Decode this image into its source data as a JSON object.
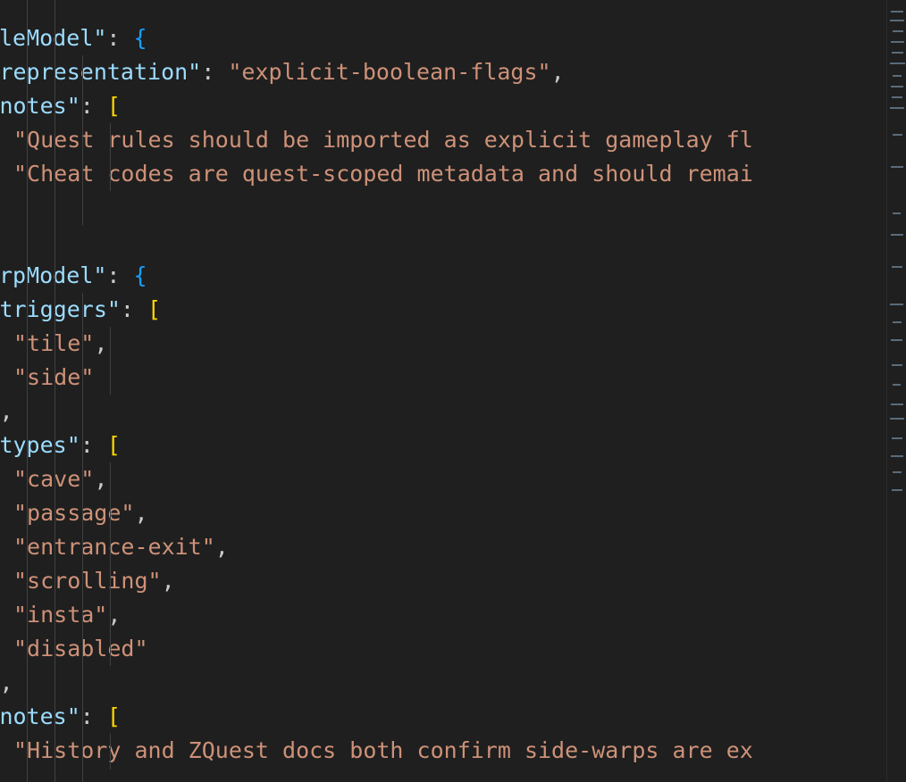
{
  "editor": {
    "language": "json",
    "colors": {
      "background": "#1f1f1f",
      "key": "#9cdcfe",
      "string": "#ce9178",
      "punctuation": "#cccccc",
      "bracket_level_1": "#179fff",
      "bracket_level_2": "#ffd700",
      "indent_guide": "#404040"
    },
    "lines": [
      {
        "indent": 3,
        "tokens": [
          {
            "t": "b1",
            "v": "}"
          },
          {
            "t": "punc",
            "v": ","
          }
        ]
      },
      {
        "indent": 3,
        "tokens": [
          {
            "t": "key",
            "v": "\"ruleModel\""
          },
          {
            "t": "punc",
            "v": ": "
          },
          {
            "t": "b1",
            "v": "{"
          }
        ]
      },
      {
        "indent": 4,
        "tokens": [
          {
            "t": "key",
            "v": "\"representation\""
          },
          {
            "t": "punc",
            "v": ": "
          },
          {
            "t": "str",
            "v": "\"explicit-boolean-flags\""
          },
          {
            "t": "punc",
            "v": ","
          }
        ]
      },
      {
        "indent": 4,
        "tokens": [
          {
            "t": "key",
            "v": "\"notes\""
          },
          {
            "t": "punc",
            "v": ": "
          },
          {
            "t": "b2",
            "v": "["
          }
        ]
      },
      {
        "indent": 5,
        "tokens": [
          {
            "t": "str",
            "v": "\"Quest rules should be imported as explicit gameplay fl"
          }
        ]
      },
      {
        "indent": 5,
        "tokens": [
          {
            "t": "str",
            "v": "\"Cheat codes are quest-scoped metadata and should remai"
          }
        ]
      },
      {
        "indent": 4,
        "tokens": [
          {
            "t": "b2",
            "v": "]"
          }
        ]
      },
      {
        "indent": 3,
        "tokens": [
          {
            "t": "b1",
            "v": "}"
          },
          {
            "t": "punc",
            "v": ","
          }
        ]
      },
      {
        "indent": 3,
        "tokens": [
          {
            "t": "key",
            "v": "\"warpModel\""
          },
          {
            "t": "punc",
            "v": ": "
          },
          {
            "t": "b1",
            "v": "{"
          }
        ]
      },
      {
        "indent": 4,
        "tokens": [
          {
            "t": "key",
            "v": "\"triggers\""
          },
          {
            "t": "punc",
            "v": ": "
          },
          {
            "t": "b2",
            "v": "["
          }
        ]
      },
      {
        "indent": 5,
        "tokens": [
          {
            "t": "str",
            "v": "\"tile\""
          },
          {
            "t": "punc",
            "v": ","
          }
        ]
      },
      {
        "indent": 5,
        "tokens": [
          {
            "t": "str",
            "v": "\"side\""
          }
        ]
      },
      {
        "indent": 4,
        "tokens": [
          {
            "t": "b2",
            "v": "]"
          },
          {
            "t": "punc",
            "v": ","
          }
        ]
      },
      {
        "indent": 4,
        "tokens": [
          {
            "t": "key",
            "v": "\"types\""
          },
          {
            "t": "punc",
            "v": ": "
          },
          {
            "t": "b2",
            "v": "["
          }
        ]
      },
      {
        "indent": 5,
        "tokens": [
          {
            "t": "str",
            "v": "\"cave\""
          },
          {
            "t": "punc",
            "v": ","
          }
        ]
      },
      {
        "indent": 5,
        "tokens": [
          {
            "t": "str",
            "v": "\"passage\""
          },
          {
            "t": "punc",
            "v": ","
          }
        ]
      },
      {
        "indent": 5,
        "tokens": [
          {
            "t": "str",
            "v": "\"entrance-exit\""
          },
          {
            "t": "punc",
            "v": ","
          }
        ]
      },
      {
        "indent": 5,
        "tokens": [
          {
            "t": "str",
            "v": "\"scrolling\""
          },
          {
            "t": "punc",
            "v": ","
          }
        ]
      },
      {
        "indent": 5,
        "tokens": [
          {
            "t": "str",
            "v": "\"insta\""
          },
          {
            "t": "punc",
            "v": ","
          }
        ]
      },
      {
        "indent": 5,
        "tokens": [
          {
            "t": "str",
            "v": "\"disabled\""
          }
        ]
      },
      {
        "indent": 4,
        "tokens": [
          {
            "t": "b2",
            "v": "]"
          },
          {
            "t": "punc",
            "v": ","
          }
        ]
      },
      {
        "indent": 4,
        "tokens": [
          {
            "t": "key",
            "v": "\"notes\""
          },
          {
            "t": "punc",
            "v": ": "
          },
          {
            "t": "b2",
            "v": "["
          }
        ]
      },
      {
        "indent": 5,
        "tokens": [
          {
            "t": "str",
            "v": "\"History and ZQuest docs both confirm side-warps are ex"
          }
        ]
      },
      {
        "indent": 4,
        "tokens": [
          {
            "t": "b2",
            "v": "]"
          }
        ]
      }
    ]
  },
  "minimap": {
    "icon": "minimap-scrollbar-icon"
  }
}
